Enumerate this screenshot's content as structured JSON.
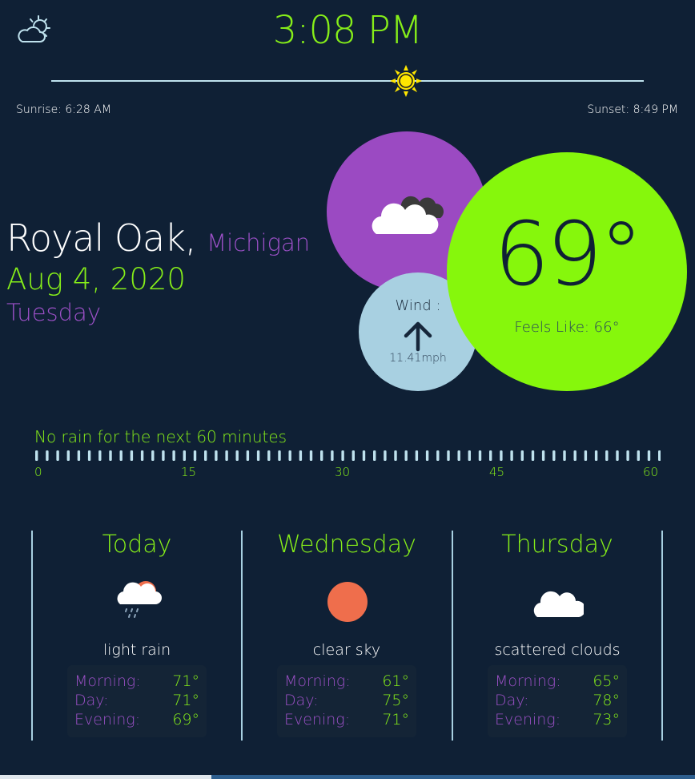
{
  "header": {
    "time": "3:08 PM",
    "icon": "partly-cloudy-day-icon",
    "sunrise": "Sunrise: 6:28 AM",
    "sunset": "Sunset: 8:49 PM",
    "sun_progress": 0.6
  },
  "location": {
    "city": "Royal Oak,",
    "state": "Michigan",
    "date": "Aug 4, 2020",
    "weekday": "Tuesday"
  },
  "current": {
    "condition_icon": "cloudy-icon",
    "temp": "69°",
    "feels_like": "Feels Like: 66°",
    "wind_label": "Wind :",
    "wind_speed": "11.41mph",
    "wind_direction_icon": "arrow-up-icon"
  },
  "rain": {
    "message": "No rain for the next 60 minutes",
    "ticks": [
      "0",
      "15",
      "30",
      "45",
      "60"
    ],
    "minute_values": 60
  },
  "forecast": [
    {
      "day": "Today",
      "icon": "rain-sun-icon",
      "desc": "light rain",
      "morning_label": "Morning:",
      "morning": "71°",
      "day_label": "Day:",
      "day_temp": "71°",
      "evening_label": "Evening:",
      "evening": "69°"
    },
    {
      "day": "Wednesday",
      "icon": "sun-icon",
      "desc": "clear sky",
      "morning_label": "Morning:",
      "morning": "61°",
      "day_label": "Day:",
      "day_temp": "75°",
      "evening_label": "Evening:",
      "evening": "71°"
    },
    {
      "day": "Thursday",
      "icon": "cloud-icon",
      "desc": "scattered clouds",
      "morning_label": "Morning:",
      "morning": "65°",
      "day_label": "Day:",
      "day_temp": "78°",
      "evening_label": "Evening:",
      "evening": "73°"
    }
  ],
  "colors": {
    "background": "#0f2035",
    "accent_green": "#86ee19",
    "accent_purple": "#9b50c6",
    "wind_blue": "#a8d0e1",
    "sun_yellow": "#ffe600",
    "sun_orange": "#ef6e4c"
  }
}
